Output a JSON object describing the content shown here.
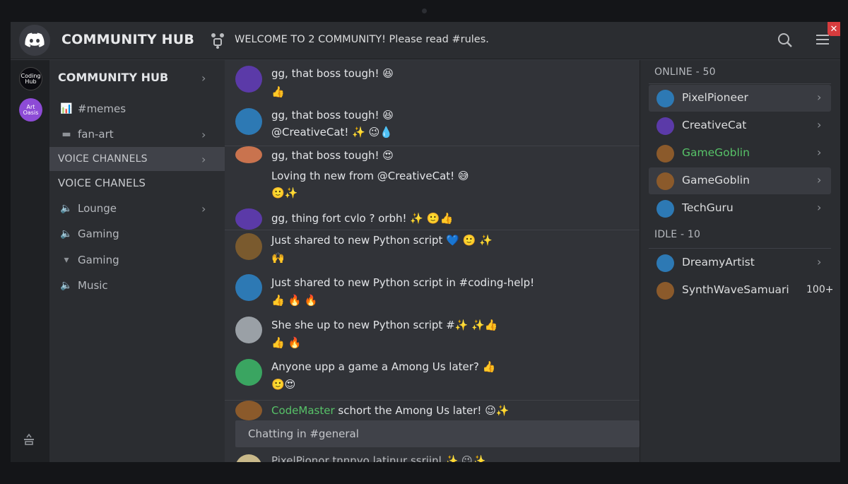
{
  "topbar": {
    "title": "COMMUNITY HUB",
    "announcement": "WELCOME TO 2 COMMUNITY! Please read #rules.",
    "close_label": "✕"
  },
  "servers": [
    {
      "label": "Coding Hub"
    },
    {
      "label": "Art Oasis"
    }
  ],
  "channels": {
    "header": "COMMUNITY HUB",
    "items": [
      {
        "label": "#memes"
      },
      {
        "label": "fan-art"
      },
      {
        "label": "VOICE CHANNELS"
      },
      {
        "label": "VOICE CHANELS"
      },
      {
        "label": "Lounge"
      },
      {
        "label": "Gaming"
      },
      {
        "label": "Gaming"
      },
      {
        "label": "Music"
      }
    ]
  },
  "messages": [
    {
      "line1": "gg, that boss tough! 😆",
      "line2": "👍"
    },
    {
      "line1": "gg, that boss tough! 😆",
      "line2": "@CreativeCat! ✨ 😉💧"
    },
    {
      "line1": "gg, that boss tough! 😍",
      "line2": "Loving th new from @CreativeCat! 😅",
      "line3": "🙂✨"
    },
    {
      "line1": "gg, thing fort cvlo ? orbh! ✨ 🙂👍"
    },
    {
      "line1": "Just shared to new Python script 💙 🙂 ✨",
      "line2": "🙌"
    },
    {
      "line1": "Just shared to new Python script in #coding-help!",
      "line2": "👍 🔥 🔥"
    },
    {
      "line1": "She she up to new Python script #✨    ✨👍",
      "line2": "👍 🔥"
    },
    {
      "line1": "Anyone upp a game a Among Us later? 👍",
      "line2": "🙂😍"
    },
    {
      "name": "CodeMaster",
      "line1": "schort the Among Us later!  😉✨"
    },
    {
      "line1": "PixelPionor tnnnyo latinur ssrijnl ✨ 😉✨"
    }
  ],
  "chat_bar": "Chatting in #general",
  "members": {
    "online_header": "ONLINE - 50",
    "idle_header": "IDLE - 10",
    "online": [
      {
        "name": "PixelPioneer",
        "color": "#dcddde"
      },
      {
        "name": "CreativeCat",
        "color": "#dcddde"
      },
      {
        "name": "GameGoblin",
        "color": "#57c268"
      },
      {
        "name": "GameGoblin",
        "color": "#dcddde"
      },
      {
        "name": "TechGuru",
        "color": "#dcddde"
      }
    ],
    "idle": [
      {
        "name": "DreamyArtist"
      },
      {
        "name": "SynthWaveSamuari",
        "count": "100+"
      }
    ]
  },
  "colors": {
    "accent_green": "#57c268",
    "close_red": "#d83c3e",
    "bg_chat": "#313338",
    "bg_sidebar": "#2b2d31"
  }
}
